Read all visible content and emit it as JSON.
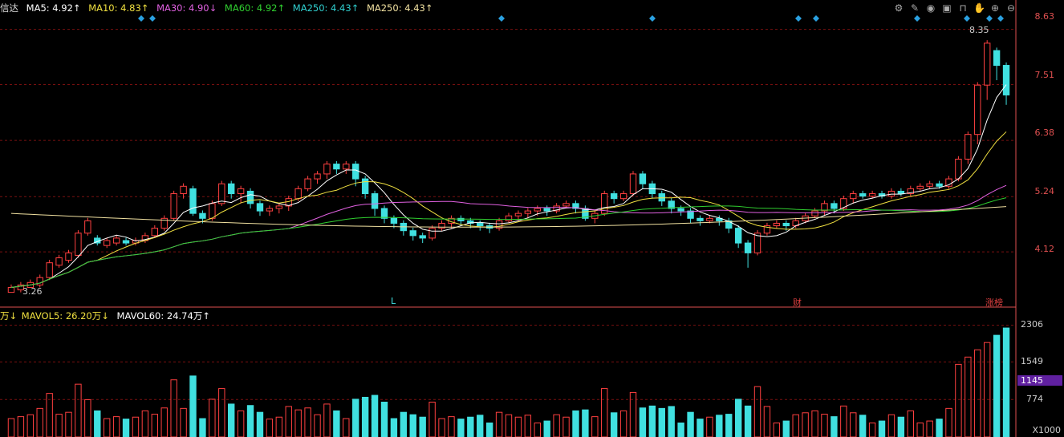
{
  "legend": {
    "stock_name": "信达",
    "ma5": {
      "label": "MA5: 4.92↑",
      "color": "#ffffff"
    },
    "ma10": {
      "label": "MA10: 4.83↑",
      "color": "#f0e040"
    },
    "ma30": {
      "label": "MA30: 4.90↓",
      "color": "#e060e0"
    },
    "ma60": {
      "label": "MA60: 4.92↑",
      "color": "#30d030"
    },
    "ma250a": {
      "label": "MA250: 4.43↑",
      "color": "#30d0d0"
    },
    "ma250b": {
      "label": "MA250: 4.43↑",
      "color": "#f0e0a0"
    }
  },
  "vol_legend": {
    "prefix": "万↓",
    "mavol5": {
      "label": "MAVOL5: 26.20万↓",
      "color": "#f0e040"
    },
    "mavol60": {
      "label": "MAVOL60: 24.74万↑",
      "color": "#ffffff"
    }
  },
  "toolbar": [
    "gear-icon",
    "pen-icon",
    "eye-icon",
    "bag-icon",
    "lock-icon",
    "hand-icon",
    "zoom-in-icon",
    "zoom-out-icon"
  ],
  "colors": {
    "up": "#ff4040",
    "down": "#40e0e0",
    "grid": "#7a1010",
    "axis": "#e05050"
  },
  "chart_data": {
    "type": "candlestick",
    "price_axis": {
      "ticks": [
        "8.63",
        "7.51",
        "6.38",
        "5.24",
        "4.12"
      ],
      "range": [
        3.05,
        8.9
      ]
    },
    "volume_axis": {
      "ticks": [
        "2306",
        "1549",
        "774",
        "X1000"
      ],
      "highlight": "1145",
      "range": [
        0,
        2400
      ]
    },
    "annotations": {
      "high": "8.35",
      "low": "3.26"
    },
    "markers": [
      {
        "label": "L",
        "index": 64
      },
      {
        "label": "财",
        "index": 131
      },
      {
        "label": "涨榜",
        "index": 163
      }
    ],
    "candles": [
      [
        3.3,
        3.4,
        3.35
      ],
      [
        3.35,
        3.45,
        3.3
      ],
      [
        3.4,
        3.5,
        3.4
      ],
      [
        3.45,
        3.6,
        3.4
      ],
      [
        3.6,
        3.9,
        3.55
      ],
      [
        3.85,
        4.0,
        3.8
      ],
      [
        3.95,
        4.1,
        3.9
      ],
      [
        4.05,
        4.5,
        4.0
      ],
      [
        4.5,
        4.75,
        4.45
      ],
      [
        4.4,
        4.3,
        4.25
      ],
      [
        4.25,
        4.35,
        4.2
      ],
      [
        4.3,
        4.4,
        4.25
      ],
      [
        4.35,
        4.3,
        4.25
      ],
      [
        4.3,
        4.35,
        4.25
      ],
      [
        4.35,
        4.45,
        4.3
      ],
      [
        4.45,
        4.6,
        4.4
      ],
      [
        4.6,
        4.8,
        4.55
      ],
      [
        4.8,
        5.3,
        4.75
      ],
      [
        5.3,
        5.45,
        5.2
      ],
      [
        5.4,
        4.9,
        4.85
      ],
      [
        4.9,
        4.8,
        4.7
      ],
      [
        4.8,
        5.1,
        4.75
      ],
      [
        5.1,
        5.5,
        5.05
      ],
      [
        5.5,
        5.3,
        5.2
      ],
      [
        5.3,
        5.4,
        5.1
      ],
      [
        5.35,
        5.1,
        5.0
      ],
      [
        5.1,
        4.95,
        4.85
      ],
      [
        4.95,
        5.0,
        4.85
      ],
      [
        5.0,
        5.05,
        4.9
      ],
      [
        5.05,
        5.2,
        4.95
      ],
      [
        5.2,
        5.4,
        5.15
      ],
      [
        5.4,
        5.6,
        5.35
      ],
      [
        5.6,
        5.7,
        5.5
      ],
      [
        5.7,
        5.9,
        5.6
      ],
      [
        5.9,
        5.8,
        5.7
      ],
      [
        5.8,
        5.9,
        5.7
      ],
      [
        5.9,
        5.6,
        5.45
      ],
      [
        5.6,
        5.3,
        5.2
      ],
      [
        5.3,
        5.0,
        4.85
      ],
      [
        5.0,
        4.8,
        4.7
      ],
      [
        4.8,
        4.7,
        4.6
      ],
      [
        4.7,
        4.55,
        4.45
      ],
      [
        4.55,
        4.45,
        4.35
      ],
      [
        4.45,
        4.4,
        4.3
      ],
      [
        4.4,
        4.6,
        4.35
      ],
      [
        4.6,
        4.7,
        4.55
      ],
      [
        4.7,
        4.8,
        4.6
      ],
      [
        4.8,
        4.75,
        4.65
      ],
      [
        4.75,
        4.7,
        4.6
      ],
      [
        4.7,
        4.65,
        4.55
      ],
      [
        4.65,
        4.6,
        4.5
      ],
      [
        4.6,
        4.75,
        4.55
      ],
      [
        4.75,
        4.85,
        4.7
      ],
      [
        4.85,
        4.9,
        4.75
      ],
      [
        4.9,
        4.95,
        4.8
      ],
      [
        4.95,
        5.0,
        4.85
      ],
      [
        5.0,
        4.95,
        4.85
      ],
      [
        4.95,
        5.05,
        4.9
      ],
      [
        5.05,
        5.1,
        5.0
      ],
      [
        5.1,
        5.0,
        4.9
      ],
      [
        5.0,
        4.8,
        4.75
      ],
      [
        4.8,
        4.9,
        4.7
      ],
      [
        4.9,
        5.3,
        4.85
      ],
      [
        5.3,
        5.2,
        5.1
      ],
      [
        5.2,
        5.3,
        5.15
      ],
      [
        5.3,
        5.7,
        5.25
      ],
      [
        5.7,
        5.5,
        5.4
      ],
      [
        5.5,
        5.3,
        5.2
      ],
      [
        5.3,
        5.15,
        5.05
      ],
      [
        5.15,
        5.0,
        4.9
      ],
      [
        5.0,
        4.95,
        4.85
      ],
      [
        4.95,
        4.8,
        4.7
      ],
      [
        4.8,
        4.75,
        4.65
      ],
      [
        4.75,
        4.8,
        4.7
      ],
      [
        4.8,
        4.75,
        4.65
      ],
      [
        4.75,
        4.6,
        4.5
      ],
      [
        4.6,
        4.3,
        4.2
      ],
      [
        4.3,
        4.1,
        3.8
      ],
      [
        4.1,
        4.5,
        4.05
      ],
      [
        4.5,
        4.65,
        4.45
      ],
      [
        4.65,
        4.7,
        4.6
      ],
      [
        4.7,
        4.65,
        4.55
      ],
      [
        4.65,
        4.75,
        4.6
      ],
      [
        4.75,
        4.85,
        4.7
      ],
      [
        4.85,
        4.95,
        4.8
      ],
      [
        4.95,
        5.1,
        4.85
      ],
      [
        5.1,
        5.0,
        4.9
      ],
      [
        5.0,
        5.2,
        4.95
      ],
      [
        5.2,
        5.3,
        5.1
      ],
      [
        5.3,
        5.25,
        5.2
      ],
      [
        5.25,
        5.3,
        5.2
      ],
      [
        5.3,
        5.25,
        5.2
      ],
      [
        5.25,
        5.35,
        5.2
      ],
      [
        5.35,
        5.3,
        5.25
      ],
      [
        5.3,
        5.4,
        5.25
      ],
      [
        5.4,
        5.45,
        5.35
      ],
      [
        5.45,
        5.5,
        5.4
      ],
      [
        5.5,
        5.45,
        5.4
      ],
      [
        5.45,
        5.6,
        5.4
      ],
      [
        5.6,
        6.0,
        5.55
      ],
      [
        6.0,
        6.5,
        5.9
      ],
      [
        6.5,
        7.5,
        6.3
      ],
      [
        7.5,
        8.35,
        7.2
      ],
      [
        8.2,
        7.9,
        7.6
      ],
      [
        7.9,
        7.3,
        7.1
      ]
    ]
  }
}
